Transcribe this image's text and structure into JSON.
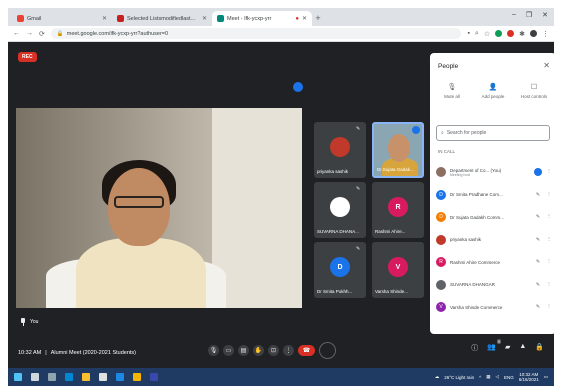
{
  "browser": {
    "tabs": [
      {
        "title": "Gmail",
        "fav_color": "#ea4335",
        "active": false
      },
      {
        "title": "Selected Listsmodifiedlast...",
        "fav_color": "#c5221f",
        "active": false
      },
      {
        "title": "Meet - Ifk-ycxp-yrr",
        "fav_color": "#00897b",
        "active": true
      }
    ],
    "new_tab": "+",
    "url": "meet.google.com/ifk-ycxp-yrr?authuser=0",
    "window_controls": [
      "–",
      "❐",
      "✕"
    ]
  },
  "meet": {
    "recording_label": "REC",
    "main_speaker_name": "You",
    "time": "10:32 AM",
    "separator": "|",
    "meeting_title": "Alumni Meet (2020-2021 Students)",
    "tiles": [
      {
        "name": "priyanka sashik",
        "initial": "",
        "color": "#c0392b"
      },
      {
        "name": "Dr.Sujata Gadak...",
        "initial": "",
        "color": "",
        "self": true
      },
      {
        "name": "SUVARNA DHANA...",
        "initial": "",
        "color": "#ffffff"
      },
      {
        "name": "Rashmi Ahire...",
        "initial": "R",
        "color": "#d81b60"
      },
      {
        "name": "Dr Smita Pokhh...",
        "initial": "D",
        "color": "#1a73e8"
      },
      {
        "name": "Varsha Shinde...",
        "initial": "V",
        "color": "#d81b60"
      }
    ],
    "people_count_badge": "9"
  },
  "people_panel": {
    "title": "People",
    "tabs": [
      {
        "label": "Mute all",
        "icon": "🎙"
      },
      {
        "label": "Add people",
        "icon": "👤"
      },
      {
        "label": "Host controls",
        "icon": "☐"
      }
    ],
    "search_placeholder": "Search for people",
    "section_label": "IN CALL",
    "participants": [
      {
        "name": "Department of Co... (You)",
        "sub": "Meeting host",
        "initial": "",
        "color": "#8d6e63"
      },
      {
        "name": "Dr Smita Pradhane Com...",
        "sub": "",
        "initial": "D",
        "color": "#1a73e8"
      },
      {
        "name": "Dr Sujata Gadakh Comm...",
        "sub": "",
        "initial": "D",
        "color": "#f57c00"
      },
      {
        "name": "priyanka sashik",
        "sub": "",
        "initial": "",
        "color": "#c0392b"
      },
      {
        "name": "Rashmi Ahire Commerce",
        "sub": "",
        "initial": "R",
        "color": "#d81b60"
      },
      {
        "name": "SUVARNA DHANGAR",
        "sub": "",
        "initial": "",
        "color": "#5f6368"
      },
      {
        "name": "Varsha Shinde Commerce",
        "sub": "",
        "initial": "V",
        "color": "#8e24aa"
      }
    ]
  },
  "taskbar": {
    "weather": "26°C Light rain",
    "lang": "ENG",
    "time": "10:32 AM",
    "date": "6/16/2021"
  }
}
